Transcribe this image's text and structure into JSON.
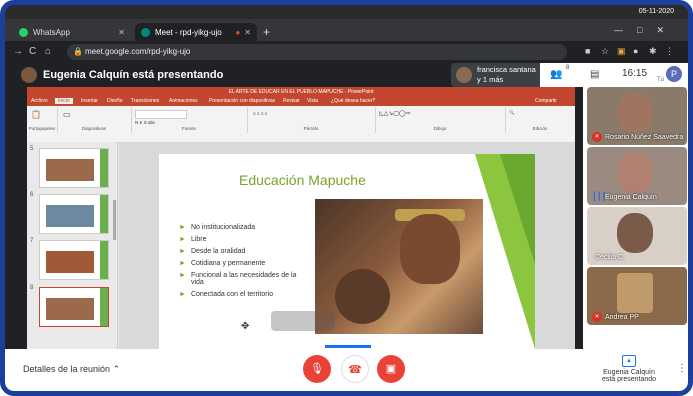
{
  "taskbar": {
    "date": "05-11-2020"
  },
  "tabs": [
    {
      "label": "WhatsApp",
      "icon": "whatsapp-icon"
    },
    {
      "label": "Meet - rpd-yikg-ujo",
      "icon": "meet-icon"
    }
  ],
  "address": {
    "url": "meet.google.com/rpd-yikg-ujo"
  },
  "meet": {
    "presenter_banner": "Eugenia Calquín está presentando",
    "pill_name": "francisca santana",
    "pill_time": "y 1 más",
    "participant_count": "8",
    "clock": "16:15",
    "you_label": "Tú",
    "avatar_letter": "P"
  },
  "ppt": {
    "window_title": "EL ARTE DE EDUCAR EN EL PUEBLO MAPUCHE - PowerPoint",
    "tabs": [
      "Archivo",
      "Inicio",
      "Insertar",
      "Diseño",
      "Transiciones",
      "Animaciones",
      "Presentación con diapositivas",
      "Revisar",
      "Vista",
      "¿Qué desea hacer?"
    ],
    "ribbon_groups": [
      "Portapapeles",
      "Diapositivas",
      "Fuente",
      "Párrafo",
      "Dibujo",
      "Edición"
    ],
    "share_label": "Compartir",
    "thumb_numbers": [
      "5",
      "6",
      "7",
      "8"
    ],
    "slide_title": "Educación Mapuche",
    "bullets": [
      "No institucionalizada",
      "Libre",
      "Desde la oralidad",
      "Cotidiana y permanente",
      "Funcional a las necesidades de la vida",
      "Conectada con el territorio"
    ]
  },
  "participants": [
    {
      "name": "Rosario Núñez Saavedra",
      "status": "muted"
    },
    {
      "name": "Eugenia Calquín",
      "status": "speaking"
    },
    {
      "name": "Cecilia C.",
      "status": "none"
    },
    {
      "name": "Andrea PP",
      "status": "muted"
    }
  ],
  "bottom": {
    "details": "Detalles de la reunión",
    "presenting_line1": "Eugenia Calquín",
    "presenting_line2": "está presentando"
  },
  "colors": {
    "frame": "#1a3f9c",
    "ppt_accent": "#c3472e",
    "slide_green": "#7ba22a",
    "meet_red": "#ea4335"
  }
}
